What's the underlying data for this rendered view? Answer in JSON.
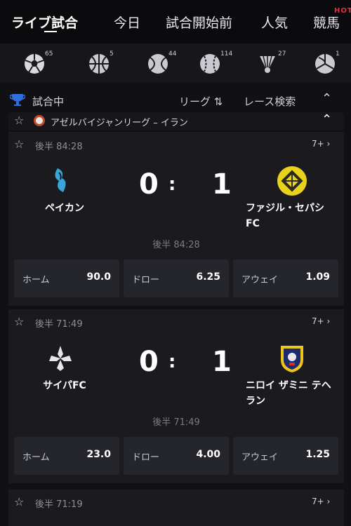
{
  "nav": {
    "tabs": [
      {
        "label": "ライブ試合"
      },
      {
        "label": "今日"
      },
      {
        "label": "試合開始前"
      },
      {
        "label": "人気"
      },
      {
        "label": "競馬"
      }
    ],
    "hot_badge": "HOT"
  },
  "sports": [
    {
      "icon": "soccer-ball-icon",
      "count": "65"
    },
    {
      "icon": "basketball-icon",
      "count": "5"
    },
    {
      "icon": "tennis-ball-icon",
      "count": "44"
    },
    {
      "icon": "baseball-icon",
      "count": "114"
    },
    {
      "icon": "badminton-icon",
      "count": "27"
    },
    {
      "icon": "volleyball-icon",
      "count": "1"
    }
  ],
  "live": {
    "title": "試合中",
    "league_filter": "リーグ ⇅",
    "race_search": "レース検索",
    "league_name": "アゼルバイジャンリーグ – イラン"
  },
  "matches": [
    {
      "time": "後半 84:28",
      "markets": "7+ ›",
      "home_team": "ペイカン",
      "away_team": "ファジル・セパシ FC",
      "home_score": "0",
      "away_score": "1",
      "odds": [
        {
          "label": "ホーム",
          "value": "90.0"
        },
        {
          "label": "ドロー",
          "value": "6.25"
        },
        {
          "label": "アウェイ",
          "value": "1.09"
        }
      ]
    },
    {
      "time": "後半 71:49",
      "markets": "7+ ›",
      "home_team": "サイパFC",
      "away_team": "ニロイ ザミニ テヘラン",
      "home_score": "0",
      "away_score": "1",
      "odds": [
        {
          "label": "ホーム",
          "value": "23.0"
        },
        {
          "label": "ドロー",
          "value": "4.00"
        },
        {
          "label": "アウェイ",
          "value": "1.25"
        }
      ]
    },
    {
      "time": "後半 71:19",
      "markets": "7+ ›"
    }
  ],
  "colors": {
    "background": "#111114",
    "card": "#1a1a1f",
    "odds_button": "#25252c",
    "hot": "#e0303a"
  }
}
